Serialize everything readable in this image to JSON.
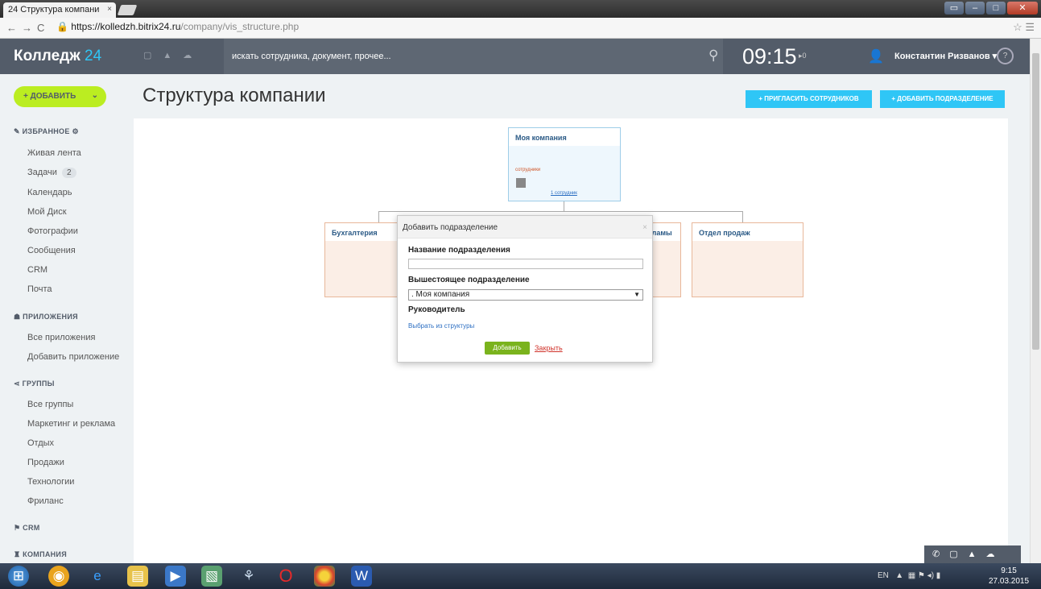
{
  "browser": {
    "tab_title": "24 Структура компани",
    "tab_close": "×",
    "url_host": "https://kolledzh.bitrix24.ru",
    "url_path": "/company/vis_structure.php"
  },
  "header": {
    "logo": "Колледж",
    "logo_num": "24",
    "search_placeholder": "искать сотрудника, документ, прочее...",
    "clock": "09:15",
    "flag_count": "0",
    "user_name": "Константин Ризванов",
    "help": "?"
  },
  "sidebar": {
    "add_label": "+ ДОБАВИТЬ",
    "favorites": "ИЗБРАННОЕ",
    "favorites_items": [
      {
        "label": "Живая лента"
      },
      {
        "label": "Задачи",
        "badge": "2"
      },
      {
        "label": "Календарь"
      },
      {
        "label": "Мой Диск"
      },
      {
        "label": "Фотографии"
      },
      {
        "label": "Сообщения"
      },
      {
        "label": "CRM"
      },
      {
        "label": "Почта"
      }
    ],
    "apps": "ПРИЛОЖЕНИЯ",
    "apps_items": [
      {
        "label": "Все приложения"
      },
      {
        "label": "Добавить приложение"
      }
    ],
    "groups": "ГРУППЫ",
    "groups_items": [
      {
        "label": "Все группы"
      },
      {
        "label": "Маркетинг и реклама"
      },
      {
        "label": "Отдых"
      },
      {
        "label": "Продажи"
      },
      {
        "label": "Технологии"
      },
      {
        "label": "Фриланс"
      }
    ],
    "crm": "CRM",
    "company": "КОМПАНИЯ"
  },
  "page": {
    "title": "Структура компании",
    "invite_btn": "+ ПРИГЛАСИТЬ СОТРУДНИКОВ",
    "add_dept_btn": "+ ДОБАВИТЬ ПОДРАЗДЕЛЕНИЕ"
  },
  "structure": {
    "root_name": "Моя компания",
    "root_employees": "сотрудники",
    "root_count": "1 сотрудник",
    "dept_1": "Бухгалтерия",
    "dept_2_partial": "кламы",
    "dept_3": "Отдел продаж"
  },
  "dialog": {
    "title": "Добавить подразделение",
    "name_label": "Название подразделения",
    "name_value": "",
    "parent_label": "Вышестоящее подразделение",
    "parent_value": ". Моя компания",
    "head_label": "Руководитель",
    "choose_link": "Выбрать из структуры",
    "ok_btn": "Добавить",
    "close_link": "Закрыть"
  },
  "taskbar": {
    "lang": "EN",
    "time": "9:15",
    "date": "27.03.2015"
  }
}
